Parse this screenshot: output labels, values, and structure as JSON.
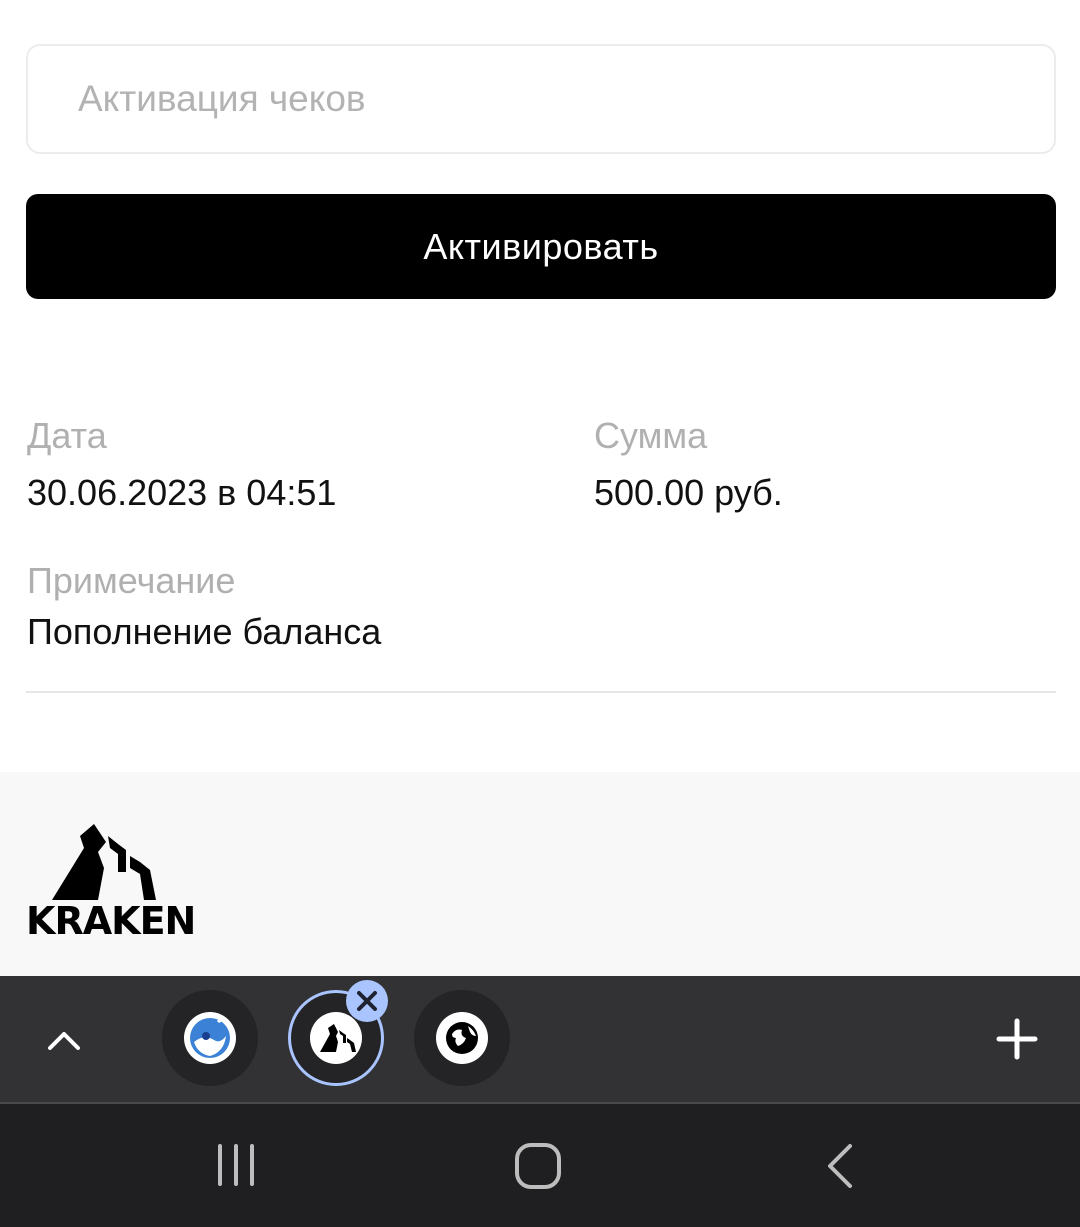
{
  "voucher": {
    "placeholder": "Активация чеков",
    "button_label": "Активировать"
  },
  "transaction": {
    "date_label": "Дата",
    "date_value": "30.06.2023 в 04:51",
    "amount_label": "Сумма",
    "amount_value": "500.00 руб.",
    "note_label": "Примечание",
    "note_value": "Пополнение баланса"
  },
  "footer": {
    "logo_text": "KRAKEN"
  },
  "tabbar": {
    "tabs": [
      {
        "icon": "whale-icon",
        "active": false
      },
      {
        "icon": "kraken-icon",
        "active": true
      },
      {
        "icon": "globe-icon",
        "active": false
      }
    ],
    "accent": "#a9c4ff"
  }
}
